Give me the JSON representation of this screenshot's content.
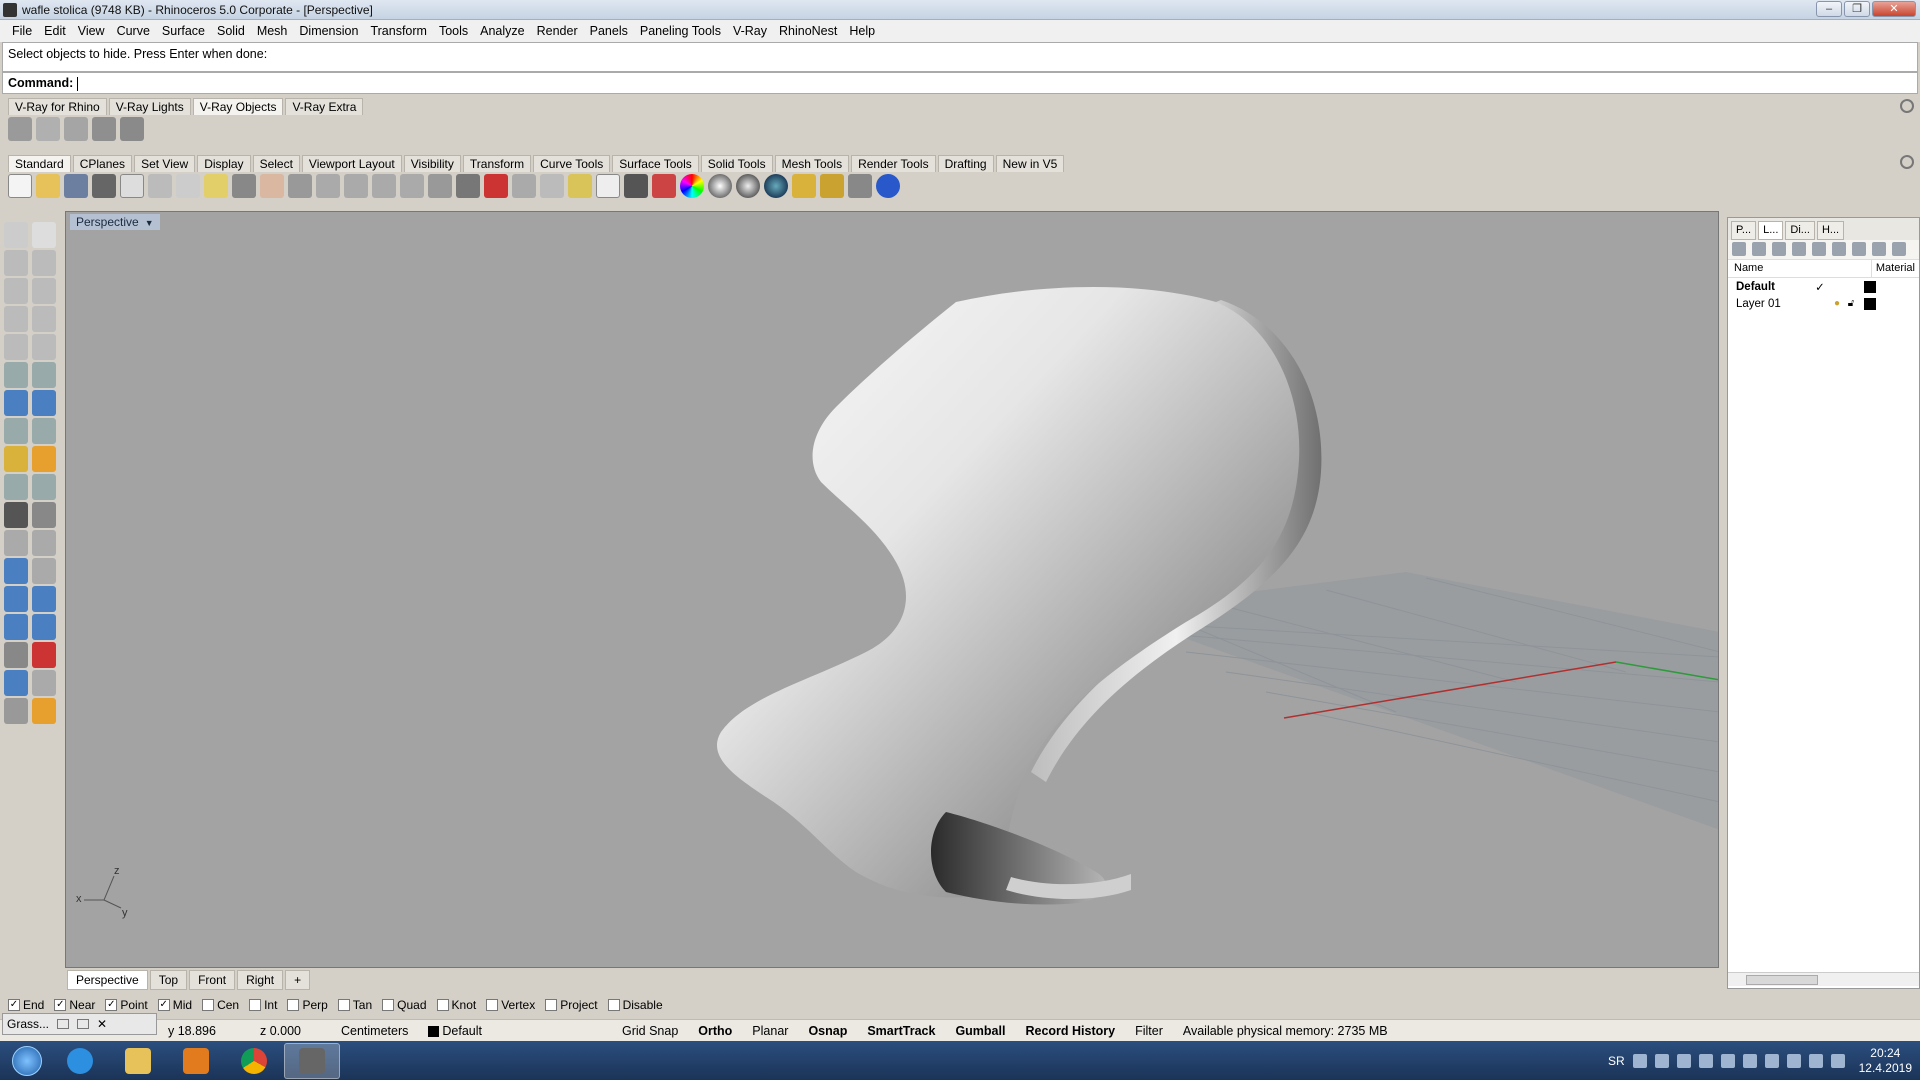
{
  "window": {
    "title": "wafle stolica (9748 KB) - Rhinoceros  5.0 Corporate - [Perspective]"
  },
  "menu": [
    "File",
    "Edit",
    "View",
    "Curve",
    "Surface",
    "Solid",
    "Mesh",
    "Dimension",
    "Transform",
    "Tools",
    "Analyze",
    "Render",
    "Panels",
    "Paneling Tools",
    "V-Ray",
    "RhinoNest",
    "Help"
  ],
  "command": {
    "history": "Select objects to hide. Press Enter when done:",
    "prompt_label": "Command:"
  },
  "vray_tabs": [
    "V-Ray for Rhino",
    "V-Ray Lights",
    "V-Ray Objects",
    "V-Ray Extra"
  ],
  "std_tabs": [
    "Standard",
    "CPlanes",
    "Set View",
    "Display",
    "Select",
    "Viewport Layout",
    "Visibility",
    "Transform",
    "Curve Tools",
    "Surface Tools",
    "Solid Tools",
    "Mesh Tools",
    "Render Tools",
    "Drafting",
    "New in V5"
  ],
  "viewport": {
    "label": "Perspective",
    "axis_labels": {
      "z": "z",
      "x": "x",
      "y": "y"
    }
  },
  "viewport_tabs": [
    "Perspective",
    "Top",
    "Front",
    "Right"
  ],
  "panel": {
    "tabs": [
      "P...",
      "L...",
      "Di...",
      "H..."
    ],
    "columns": {
      "name": "Name",
      "material": "Material"
    },
    "layers": [
      {
        "name": "Default",
        "current": "✓"
      },
      {
        "name": "Layer 01",
        "current": ""
      }
    ]
  },
  "osnaps": [
    {
      "label": "End",
      "checked": true
    },
    {
      "label": "Near",
      "checked": true
    },
    {
      "label": "Point",
      "checked": true
    },
    {
      "label": "Mid",
      "checked": true
    },
    {
      "label": "Cen",
      "checked": false
    },
    {
      "label": "Int",
      "checked": false
    },
    {
      "label": "Perp",
      "checked": false
    },
    {
      "label": "Tan",
      "checked": false
    },
    {
      "label": "Quad",
      "checked": false
    },
    {
      "label": "Knot",
      "checked": false
    },
    {
      "label": "Vertex",
      "checked": false
    },
    {
      "label": "Project",
      "checked": false
    },
    {
      "label": "Disable",
      "checked": false
    }
  ],
  "grasshopper": {
    "label": "Grass..."
  },
  "status": {
    "y": "y 18.896",
    "z": "z 0.000",
    "units": "Centimeters",
    "layer": "Default",
    "grid_snap": "Grid Snap",
    "ortho": "Ortho",
    "planar": "Planar",
    "osnap": "Osnap",
    "smarttrack": "SmartTrack",
    "gumball": "Gumball",
    "record_history": "Record History",
    "filter": "Filter",
    "memory": "Available physical memory: 2735 MB"
  },
  "taskbar": {
    "lang": "SR",
    "time": "20:24",
    "date": "12.4.2019"
  }
}
